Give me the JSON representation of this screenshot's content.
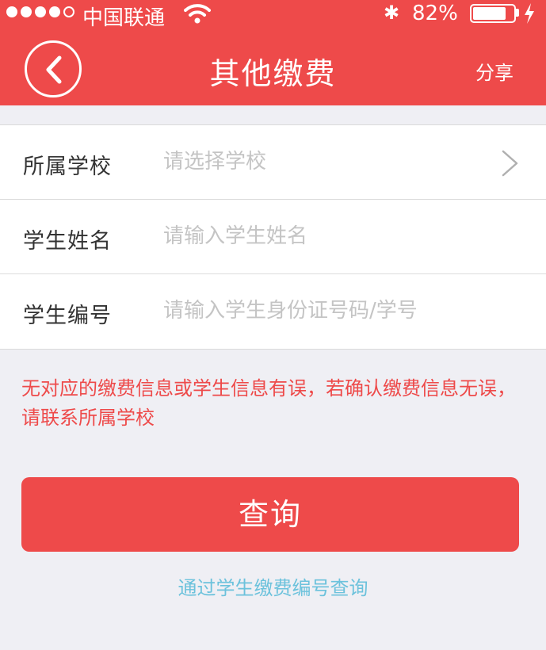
{
  "status_bar": {
    "carrier": "中国联通",
    "signal_bars": 4,
    "signal_max": 5,
    "bluetooth_icon": "bluetooth-icon",
    "battery_percent": "82%",
    "battery_level": 0.82
  },
  "nav": {
    "title": "其他缴费",
    "share_label": "分享",
    "back_icon": "back-arrow-icon"
  },
  "form": {
    "school": {
      "label": "所属学校",
      "placeholder": "请选择学校"
    },
    "name": {
      "label": "学生姓名",
      "placeholder": "请输入学生姓名"
    },
    "number": {
      "label": "学生编号",
      "placeholder": "请输入学生身份证号码/学号"
    }
  },
  "error_message": "无对应的缴费信息或学生信息有误，若确认缴费信息无误，请联系所属学校",
  "query_button_label": "查询",
  "alt_query_link": "通过学生缴费编号查询",
  "colors": {
    "accent": "#ee4a4a",
    "background": "#efeff4",
    "link": "#6cc2dc",
    "placeholder": "#c4c4c4"
  }
}
